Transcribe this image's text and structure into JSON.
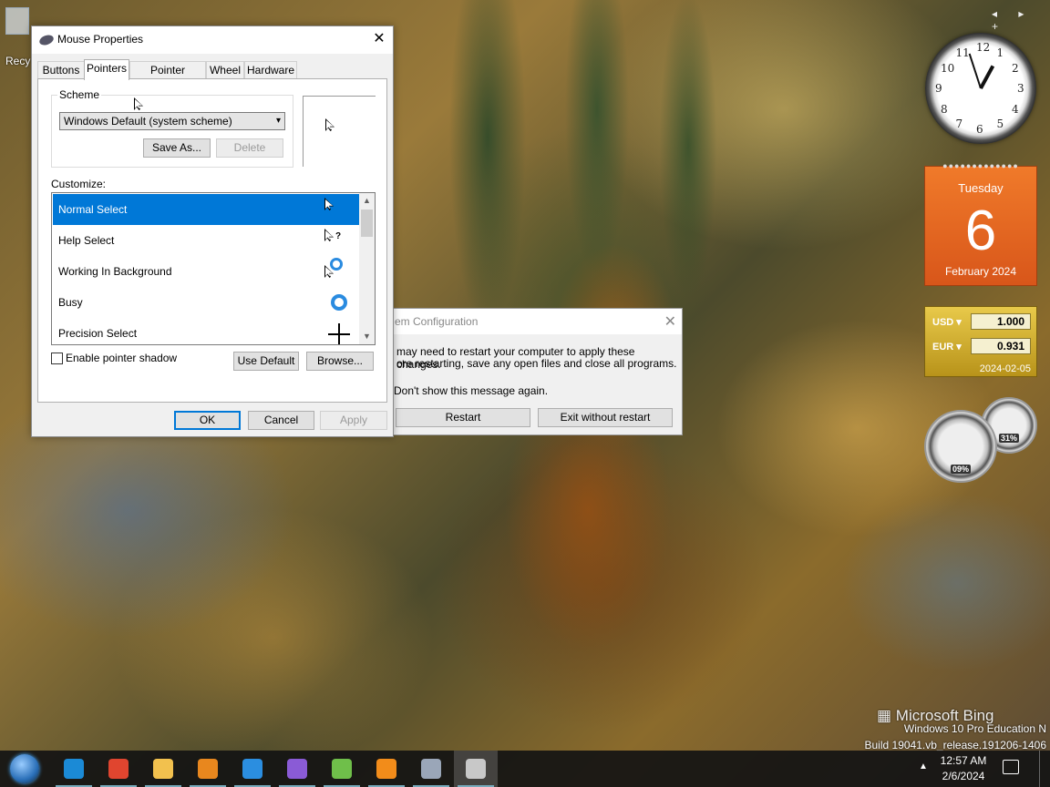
{
  "desktop": {
    "recycle_bin_label": "Recy",
    "watermark": "Microsoft Bing",
    "os_version_line1": "Windows 10 Pro Education N",
    "os_version_line2": "Build 19041.vb_release.191206-1406"
  },
  "mouse_properties": {
    "title": "Mouse Properties",
    "close_glyph": "✕",
    "tabs": [
      {
        "label": "Buttons"
      },
      {
        "label": "Pointers"
      },
      {
        "label": "Pointer Options"
      },
      {
        "label": "Wheel"
      },
      {
        "label": "Hardware"
      }
    ],
    "active_tab": "Pointers",
    "scheme": {
      "group_label": "Scheme",
      "selected_value": "Windows Default (system scheme)",
      "save_as_label": "Save As...",
      "delete_label": "Delete"
    },
    "customize_label": "Customize:",
    "pointer_list": [
      {
        "label": "Normal Select",
        "selected": true
      },
      {
        "label": "Help Select",
        "selected": false
      },
      {
        "label": "Working In Background",
        "selected": false
      },
      {
        "label": "Busy",
        "selected": false
      },
      {
        "label": "Precision Select",
        "selected": false
      }
    ],
    "help_glyph": "?",
    "enable_shadow_label": "Enable pointer shadow",
    "enable_shadow_checked": false,
    "use_default_label": "Use Default",
    "browse_label": "Browse...",
    "ok_label": "OK",
    "cancel_label": "Cancel",
    "apply_label": "Apply"
  },
  "system_config": {
    "title_visible": "em Configuration",
    "close_glyph": "✕",
    "message_line1": "may need to restart your computer to apply these changes.",
    "message_line2": "ore restarting, save any open files and close all programs.",
    "dont_show_label": "Don't show this message again.",
    "restart_label": "Restart",
    "exit_label": "Exit without restart"
  },
  "gadgets": {
    "gadget_controls": "◂ ▸ +",
    "clock_numbers": [
      "12",
      "1",
      "2",
      "3",
      "4",
      "5",
      "6",
      "7",
      "8",
      "9",
      "10",
      "11"
    ],
    "clock_hour": 0,
    "clock_minute": 57,
    "calendar": {
      "day_of_week": "Tuesday",
      "day": "6",
      "month_year": "February 2024"
    },
    "currency": {
      "rows": [
        {
          "code": "USD",
          "value": "1.000"
        },
        {
          "code": "EUR",
          "value": "0.931"
        }
      ],
      "dropdown_glyph": "▾",
      "date": "2024-02-05"
    },
    "cpu_percent": "09%",
    "ram_percent": "31%"
  },
  "taskbar": {
    "apps": [
      {
        "name": "edge",
        "color": "#1b8ad6"
      },
      {
        "name": "chrome",
        "color": "#e0452f"
      },
      {
        "name": "file-explorer",
        "color": "#f2c14e"
      },
      {
        "name": "firefox",
        "color": "#e8871e"
      },
      {
        "name": "vs-code",
        "color": "#2b8ee0"
      },
      {
        "name": "visual-studio",
        "color": "#8a5bd6"
      },
      {
        "name": "notepad-plus",
        "color": "#6fbf4a"
      },
      {
        "name": "search-tool",
        "color": "#f28c1a"
      },
      {
        "name": "system-config",
        "color": "#9aa6b8"
      },
      {
        "name": "mouse-properties",
        "color": "#c8c8c8"
      }
    ],
    "tray_up_glyph": "▲",
    "time": "12:57 AM",
    "date": "2/6/2024"
  }
}
